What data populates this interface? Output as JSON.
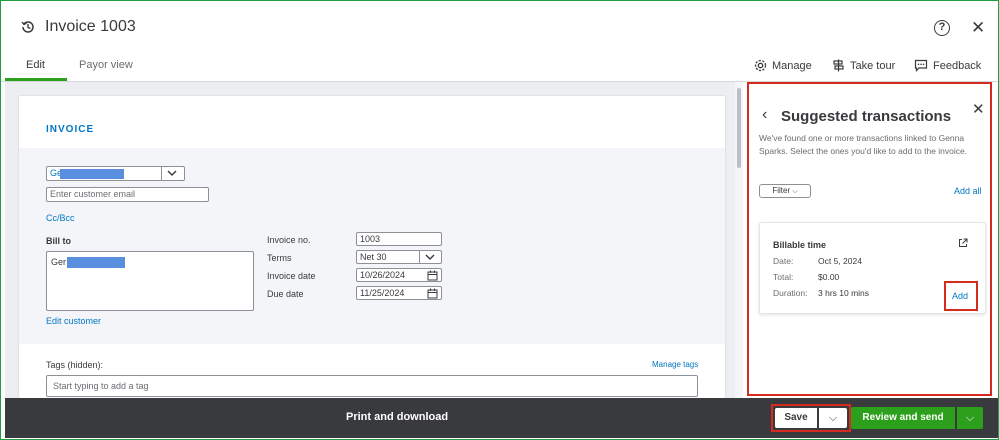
{
  "window": {
    "title": "Invoice 1003"
  },
  "tabs": [
    {
      "label": "Edit"
    },
    {
      "label": "Payor view"
    }
  ],
  "header_actions": {
    "manage": "Manage",
    "take_tour": "Take tour",
    "feedback": "Feedback"
  },
  "invoice": {
    "heading": "INVOICE",
    "customer_name": "Ge",
    "email_placeholder": "Enter customer email",
    "cc_bcc": "Cc/Bcc",
    "bill_to_label": "Bill to",
    "bill_to_value": "Ger",
    "edit_customer": "Edit customer",
    "invoice_no_label": "Invoice no.",
    "invoice_no": "1003",
    "terms_label": "Terms",
    "terms": "Net 30",
    "invoice_date_label": "Invoice date",
    "invoice_date": "10/26/2024",
    "due_date_label": "Due date",
    "due_date": "11/25/2024",
    "tags_label": "Tags (hidden):",
    "manage_tags": "Manage tags",
    "tags_placeholder": "Start typing to add a tag"
  },
  "panel": {
    "title": "Suggested transactions",
    "description": "We've found one or more transactions linked to Genna Sparks. Select the ones you'd like to add to the invoice.",
    "filter": "Filter",
    "add_all": "Add all",
    "card": {
      "title": "Billable time",
      "date_label": "Date:",
      "date": "Oct 5, 2024",
      "total_label": "Total:",
      "total": "$0.00",
      "duration_label": "Duration:",
      "duration": "3 hrs 10 mins",
      "add": "Add"
    }
  },
  "footer": {
    "print": "Print and download",
    "save": "Save",
    "review": "Review and send"
  },
  "colors": {
    "accent_green": "#2ca01c",
    "link_blue": "#0077c5",
    "highlight_red": "#d52b1e",
    "footer_dark": "#393a3d"
  }
}
